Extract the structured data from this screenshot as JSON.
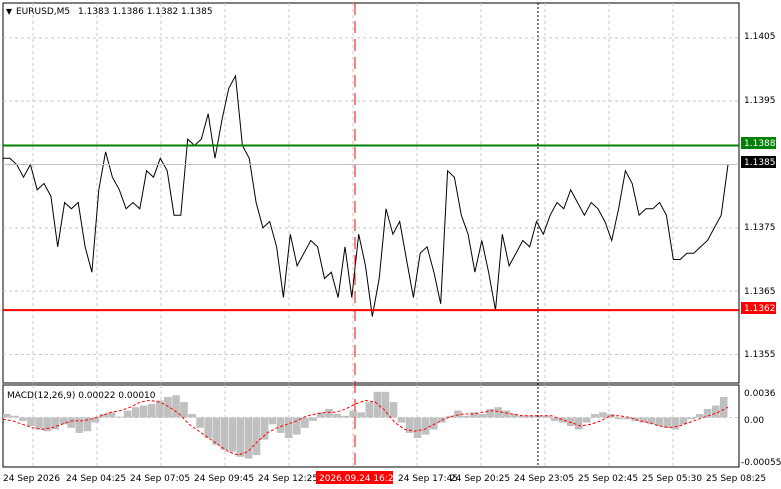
{
  "header": {
    "symbol": "EURUSD,M5",
    "ohlc": "1.1383 1.1386 1.1382 1.1385"
  },
  "price_axis": {
    "ticks": [
      "1.1405",
      "1.1395",
      "1.1375",
      "1.1365",
      "1.1355"
    ],
    "tick_values": [
      1.1405,
      1.1395,
      1.1375,
      1.1365,
      1.1355
    ]
  },
  "levels": {
    "resistance": {
      "label": "1.1388",
      "value": 1.1388,
      "color": "#008000"
    },
    "current": {
      "label": "1.1385",
      "value": 1.1385
    },
    "support": {
      "label": "1.1362",
      "value": 1.1362,
      "color": "#ff0000"
    }
  },
  "macd": {
    "label": "MACD(12,26,9) 0.00022 0.00010",
    "ticks": [
      "0.0036",
      "0.00",
      "-0.00055"
    ]
  },
  "time_axis": {
    "labels": [
      "24 Sep 2026",
      "24 Sep 04:25",
      "24 Sep 07:05",
      "24 Sep 09:45",
      "24 Sep 12:25",
      "2026.09.24 16:25",
      "24 Sep 17:45",
      "24 Sep 20:25",
      "24 Sep 23:05",
      "25 Sep 02:45",
      "25 Sep 05:30",
      "25 Sep 08:25"
    ],
    "highlight_label": "2026.09.24 16:25"
  },
  "chart_data": {
    "type": "line",
    "price_range": [
      1.13505,
      1.14105
    ],
    "macd_range": [
      -0.00058,
      0.00038
    ],
    "price": [
      1.1386,
      1.1386,
      1.1385,
      1.1383,
      1.1385,
      1.1381,
      1.1382,
      1.138,
      1.1372,
      1.1379,
      1.1378,
      1.1379,
      1.1372,
      1.1368,
      1.1381,
      1.1387,
      1.1383,
      1.1381,
      1.1378,
      1.1379,
      1.1378,
      1.1384,
      1.1383,
      1.1386,
      1.1384,
      1.1377,
      1.1377,
      1.1389,
      1.1388,
      1.1389,
      1.1393,
      1.1386,
      1.1392,
      1.1397,
      1.1399,
      1.1388,
      1.1386,
      1.1379,
      1.1375,
      1.1376,
      1.1372,
      1.1364,
      1.1374,
      1.1369,
      1.1371,
      1.1373,
      1.1372,
      1.1367,
      1.1368,
      1.1364,
      1.1372,
      1.1364,
      1.1374,
      1.1369,
      1.1361,
      1.1367,
      1.1378,
      1.1374,
      1.1376,
      1.137,
      1.1364,
      1.1371,
      1.1372,
      1.1368,
      1.1363,
      1.1384,
      1.1383,
      1.1377,
      1.1374,
      1.1368,
      1.1373,
      1.1368,
      1.1362,
      1.1374,
      1.1369,
      1.1371,
      1.1373,
      1.1372,
      1.1376,
      1.1374,
      1.1377,
      1.1379,
      1.1378,
      1.1381,
      1.1379,
      1.1377,
      1.1379,
      1.1378,
      1.1376,
      1.1373,
      1.1378,
      1.1384,
      1.1382,
      1.1377,
      1.1378,
      1.1378,
      1.1379,
      1.1377,
      1.137,
      1.137,
      1.1371,
      1.1371,
      1.1372,
      1.1373,
      1.1375,
      1.1377,
      1.1385
    ],
    "macd_hist": [
      4e-05,
      2e-05,
      -4e-05,
      -0.0001,
      -0.00014,
      -0.00016,
      -0.00014,
      -8e-05,
      -0.00012,
      -0.00018,
      -0.00016,
      -6e-05,
      4e-05,
      6e-05,
      1e-05,
      8e-05,
      0.00012,
      0.00014,
      0.00016,
      0.0002,
      0.00024,
      0.00026,
      0.00018,
      4e-05,
      -0.00012,
      -0.00024,
      -0.00032,
      -0.00038,
      -0.0004,
      -0.00046,
      -0.00048,
      -0.00044,
      -0.00026,
      -8e-05,
      -0.00018,
      -0.00024,
      -0.0002,
      -0.00012,
      -4e-05,
      6e-05,
      0.0001,
      4e-05,
      2e-05,
      8e-05,
      6e-05,
      0.00018,
      0.0003,
      0.0003,
      0.00018,
      -6e-05,
      -0.00018,
      -0.00024,
      -0.0002,
      -0.00014,
      -6e-05,
      2e-05,
      8e-05,
      2e-05,
      6e-05,
      4e-05,
      0.0001,
      0.00012,
      8e-05,
      4e-05,
      2e-05,
      2e-05,
      2e-05,
      2e-05,
      -4e-05,
      -6e-05,
      -0.0001,
      -0.00014,
      -6e-05,
      4e-05,
      6e-05,
      4e-05,
      -2e-05,
      -2e-05,
      -4e-05,
      -6e-05,
      -8e-05,
      -0.0001,
      -0.00012,
      -0.00014,
      -8e-05,
      -2e-05,
      4e-05,
      0.0001,
      0.00014,
      0.00024
    ],
    "macd_signal": [
      -2e-05,
      -4e-05,
      -8e-05,
      -0.00012,
      -0.00014,
      -0.00012,
      -8e-05,
      -4e-05,
      -4e-05,
      -2e-05,
      2e-05,
      6e-05,
      8e-05,
      0.00012,
      0.00018,
      0.0002,
      0.00018,
      0.00012,
      4e-05,
      -8e-05,
      -0.00016,
      -0.00024,
      -0.00032,
      -0.0004,
      -0.00044,
      -0.0004,
      -0.00028,
      -0.00018,
      -0.00012,
      -8e-05,
      -4e-05,
      2e-05,
      4e-05,
      6e-05,
      6e-05,
      0.0001,
      0.00016,
      0.0002,
      0.00018,
      8e-05,
      -6e-05,
      -0.00014,
      -0.00016,
      -0.00014,
      -8e-05,
      -2e-05,
      2e-05,
      4e-05,
      4e-05,
      6e-05,
      8e-05,
      6e-05,
      4e-05,
      2e-05,
      2e-05,
      2e-05,
      2e-05,
      -2e-05,
      -6e-05,
      -0.0001,
      -8e-05,
      -4e-05,
      2e-05,
      2e-05,
      0,
      -4e-05,
      -6e-05,
      -0.0001,
      -0.00012,
      -0.0001,
      -6e-05,
      -2e-05,
      2e-05,
      6e-05,
      0.00012
    ],
    "vertical_markers": [
      {
        "label": "2026.09.24 16:25",
        "style": "dashed-red"
      },
      {
        "label": "24 Sep 23:05",
        "style": "dotted-black"
      }
    ]
  }
}
